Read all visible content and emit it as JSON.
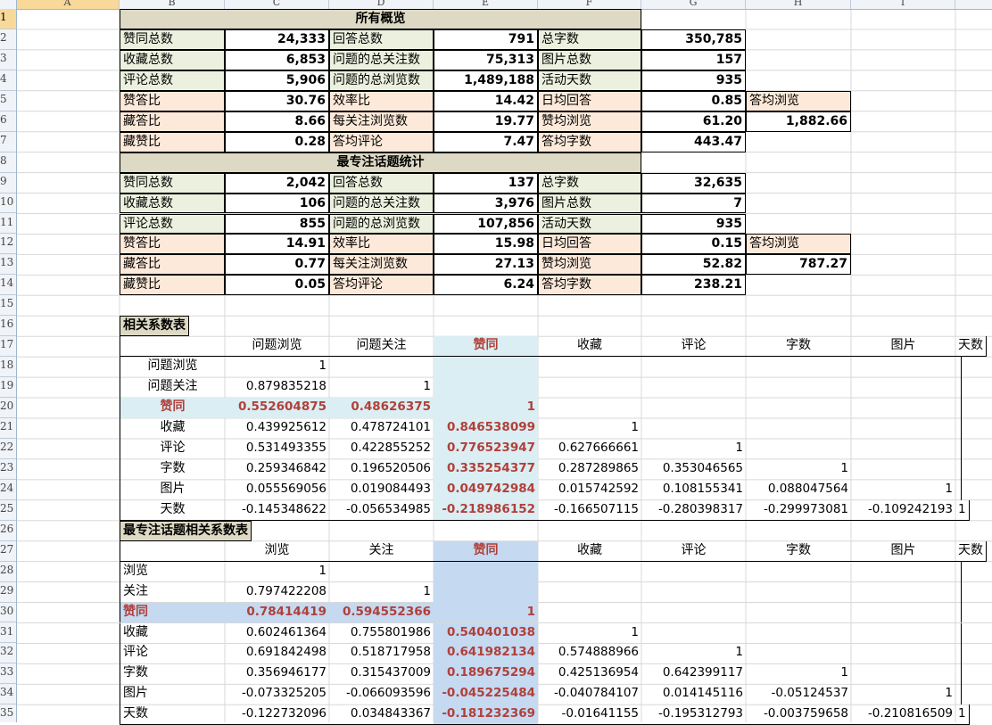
{
  "columns": [
    "A",
    "B",
    "C",
    "D",
    "E",
    "F",
    "G",
    "H",
    "I"
  ],
  "row_numbers": [
    "1",
    "2",
    "3",
    "4",
    "5",
    "6",
    "7",
    "8",
    "9",
    "10",
    "11",
    "12",
    "13",
    "14",
    "15",
    "16",
    "17",
    "18",
    "19",
    "20",
    "21",
    "22",
    "23",
    "24",
    "25",
    "26",
    "27",
    "28",
    "29",
    "30",
    "31",
    "32",
    "33",
    "34",
    "35"
  ],
  "overview": {
    "title": "所有概览",
    "rows": [
      [
        "赞同总数",
        "24,333",
        "回答总数",
        "791",
        "总字数",
        "350,785"
      ],
      [
        "收藏总数",
        "6,853",
        "问题的总关注数",
        "75,313",
        "图片总数",
        "157"
      ],
      [
        "评论总数",
        "5,906",
        "问题的总浏览数",
        "1,489,188",
        "活动天数",
        "935"
      ],
      [
        "赞答比",
        "30.76",
        "效率比",
        "14.42",
        "日均回答",
        "0.85"
      ],
      [
        "藏答比",
        "8.66",
        "每关注浏览数",
        "19.77",
        "赞均浏览",
        "61.20"
      ],
      [
        "藏赞比",
        "0.28",
        "答均评论",
        "7.47",
        "答均字数",
        "443.47"
      ]
    ],
    "extra_label": "答均浏览",
    "extra_value": "1,882.66"
  },
  "topic": {
    "title": "最专注话题统计",
    "rows": [
      [
        "赞同总数",
        "2,042",
        "回答总数",
        "137",
        "总字数",
        "32,635"
      ],
      [
        "收藏总数",
        "106",
        "问题的总关注数",
        "3,976",
        "图片总数",
        "7"
      ],
      [
        "评论总数",
        "855",
        "问题的总浏览数",
        "107,856",
        "活动天数",
        "935"
      ],
      [
        "赞答比",
        "14.91",
        "效率比",
        "15.98",
        "日均回答",
        "0.15"
      ],
      [
        "藏答比",
        "0.77",
        "每关注浏览数",
        "27.13",
        "赞均浏览",
        "52.82"
      ],
      [
        "藏赞比",
        "0.05",
        "答均评论",
        "6.24",
        "答均字数",
        "238.21"
      ]
    ],
    "extra_label": "答均浏览",
    "extra_value": "787.27"
  },
  "corr1": {
    "title": "相关系数表",
    "headers": [
      "问题浏览",
      "问题关注",
      "赞同",
      "收藏",
      "评论",
      "字数",
      "图片",
      "天数"
    ],
    "rows": [
      {
        "label": "问题浏览",
        "values": [
          "1",
          "",
          "",
          "",
          "",
          "",
          "",
          ""
        ]
      },
      {
        "label": "问题关注",
        "values": [
          "0.879835218",
          "1",
          "",
          "",
          "",
          "",
          "",
          ""
        ]
      },
      {
        "label": "赞同",
        "values": [
          "0.552604875",
          "0.48626375",
          "1",
          "",
          "",
          "",
          "",
          ""
        ]
      },
      {
        "label": "收藏",
        "values": [
          "0.439925612",
          "0.478724101",
          "0.846538099",
          "1",
          "",
          "",
          "",
          ""
        ]
      },
      {
        "label": "评论",
        "values": [
          "0.531493355",
          "0.422855252",
          "0.776523947",
          "0.627666661",
          "1",
          "",
          "",
          ""
        ]
      },
      {
        "label": "字数",
        "values": [
          "0.259346842",
          "0.196520506",
          "0.335254377",
          "0.287289865",
          "0.353046565",
          "1",
          "",
          ""
        ]
      },
      {
        "label": "图片",
        "values": [
          "0.055569056",
          "0.019084493",
          "0.049742984",
          "0.015742592",
          "0.108155341",
          "0.088047564",
          "1",
          ""
        ]
      },
      {
        "label": "天数",
        "values": [
          "-0.145348622",
          "-0.056534985",
          "-0.218986152",
          "-0.166507115",
          "-0.280398317",
          "-0.299973081",
          "-0.109242193",
          "1"
        ]
      }
    ]
  },
  "corr2": {
    "title": "最专注话题相关系数表",
    "headers": [
      "浏览",
      "关注",
      "赞同",
      "收藏",
      "评论",
      "字数",
      "图片",
      "天数"
    ],
    "rows": [
      {
        "label": "浏览",
        "values": [
          "1",
          "",
          "",
          "",
          "",
          "",
          "",
          ""
        ]
      },
      {
        "label": "关注",
        "values": [
          "0.797422208",
          "1",
          "",
          "",
          "",
          "",
          "",
          ""
        ]
      },
      {
        "label": "赞同",
        "values": [
          "0.78414419",
          "0.594552366",
          "1",
          "",
          "",
          "",
          "",
          ""
        ]
      },
      {
        "label": "收藏",
        "values": [
          "0.602461364",
          "0.755801986",
          "0.540401038",
          "1",
          "",
          "",
          "",
          ""
        ]
      },
      {
        "label": "评论",
        "values": [
          "0.691842498",
          "0.518717958",
          "0.641982134",
          "0.574888966",
          "1",
          "",
          "",
          ""
        ]
      },
      {
        "label": "字数",
        "values": [
          "0.356946177",
          "0.315437009",
          "0.189675294",
          "0.425136954",
          "0.642399117",
          "1",
          "",
          ""
        ]
      },
      {
        "label": "图片",
        "values": [
          "-0.073325205",
          "-0.066093596",
          "-0.045225484",
          "-0.040784107",
          "0.014145116",
          "-0.05124537",
          "1",
          ""
        ]
      },
      {
        "label": "天数",
        "values": [
          "-0.122732096",
          "0.034843367",
          "-0.181232369",
          "-0.01641155",
          "-0.195312793",
          "-0.003759658",
          "-0.210816509",
          "1"
        ]
      }
    ]
  },
  "colors": {
    "title_band": "#ddd9c4",
    "label_green": "#ebf1de",
    "label_peach": "#fde9d9",
    "highlight_light_blue": "#dbeef3",
    "highlight_blue": "#c5d9f1",
    "highlight_text": "#b0403a"
  }
}
